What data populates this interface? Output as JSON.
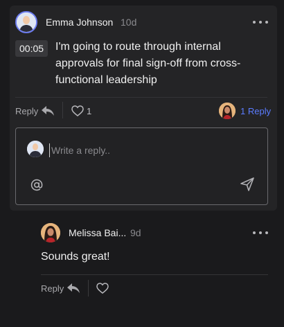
{
  "comment": {
    "author": "Emma Johnson",
    "time_ago": "10d",
    "timestamp": "00:05",
    "text": "I'm going to route through internal approvals for final sign-off from cross-functional leadership",
    "reply_label": "Reply",
    "like_count": "1",
    "replies_label": "1 Reply"
  },
  "reply_box": {
    "placeholder": "Write a reply.."
  },
  "reply": {
    "author": "Melissa Bai...",
    "time_ago": "9d",
    "text": "Sounds great!",
    "reply_label": "Reply"
  },
  "colors": {
    "accent": "#5b7cff",
    "background": "#1a1a1c",
    "card": "#242426"
  },
  "icons": [
    "more-icon",
    "reply-arrow-icon",
    "heart-icon",
    "at-icon",
    "send-icon"
  ]
}
